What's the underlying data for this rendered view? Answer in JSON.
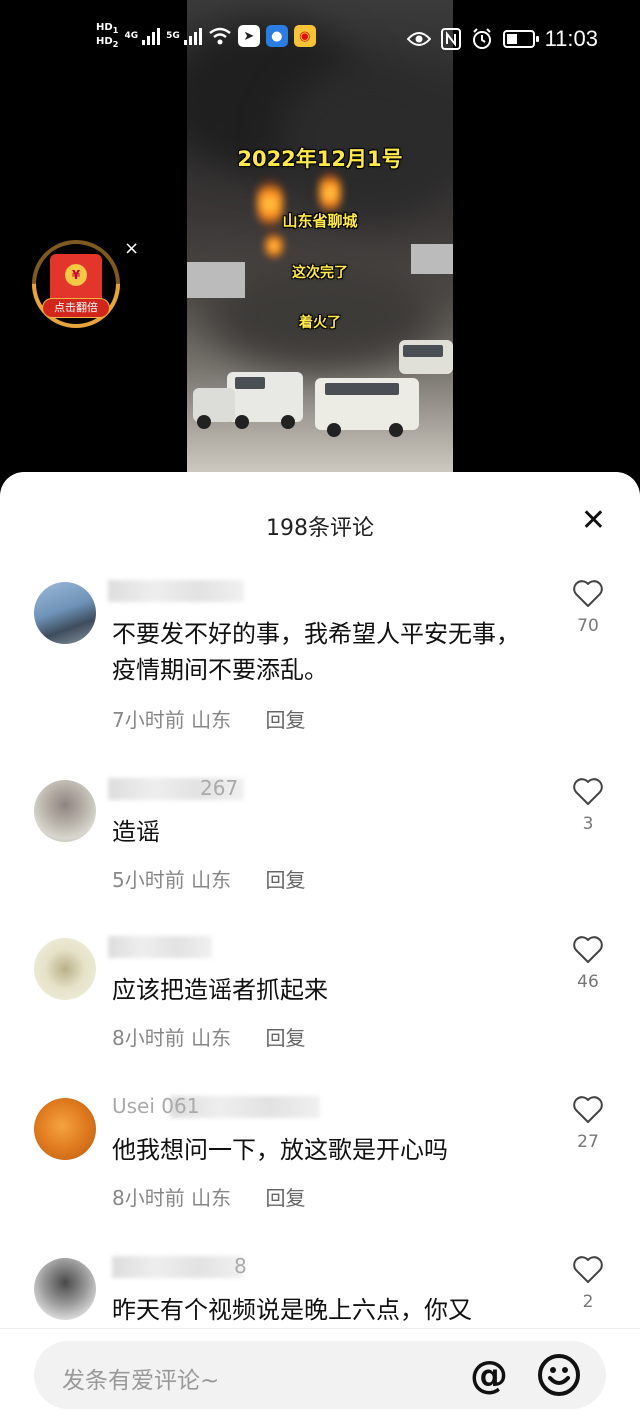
{
  "status_bar": {
    "sim1": "HD",
    "sim2": "HD",
    "sim1_index": "1",
    "sim2_index": "2",
    "net1": "4G",
    "net2": "5G",
    "time": "11:03",
    "battery_level": 0.45,
    "icons": [
      "wifi-icon",
      "app-arrow-icon",
      "app-bulb-icon",
      "weibo-icon",
      "eye-icon",
      "nfc-icon",
      "alarm-icon",
      "battery-icon"
    ]
  },
  "video": {
    "caption_date": "2022年12月1号",
    "caption_1": "山东省聊城",
    "caption_2": "这次完了",
    "caption_3": "着火了"
  },
  "red_packet": {
    "coin": "¥",
    "label": "点击翻倍",
    "close": "×"
  },
  "comments_panel": {
    "title": "198条评论",
    "close": "✕",
    "comments": [
      {
        "user": "",
        "text": "不要发不好的事，我希望人平安无事，疫情期间不要添乱。",
        "time": "7小时前",
        "location": "山东",
        "reply": "回复",
        "likes": "70"
      },
      {
        "user": "267",
        "text": "造谣",
        "time": "5小时前",
        "location": "山东",
        "reply": "回复",
        "likes": "3"
      },
      {
        "user": "",
        "text": "应该把造谣者抓起来",
        "time": "8小时前",
        "location": "山东",
        "reply": "回复",
        "likes": "46"
      },
      {
        "user": "Usei 061",
        "text": "他我想问一下，放这歌是开心吗",
        "time": "8小时前",
        "location": "山东",
        "reply": "回复",
        "likes": "27"
      },
      {
        "user": "8",
        "text": "昨天有个视频说是晚上六点，你又",
        "time": "",
        "location": "",
        "reply": "",
        "likes": "2"
      }
    ]
  },
  "input_bar": {
    "placeholder": "发条有爱评论~",
    "mention_icon": "@"
  },
  "colors": {
    "caption": "#ffe94a",
    "red_packet": "#e4352c",
    "ring": "#e6a43a"
  }
}
